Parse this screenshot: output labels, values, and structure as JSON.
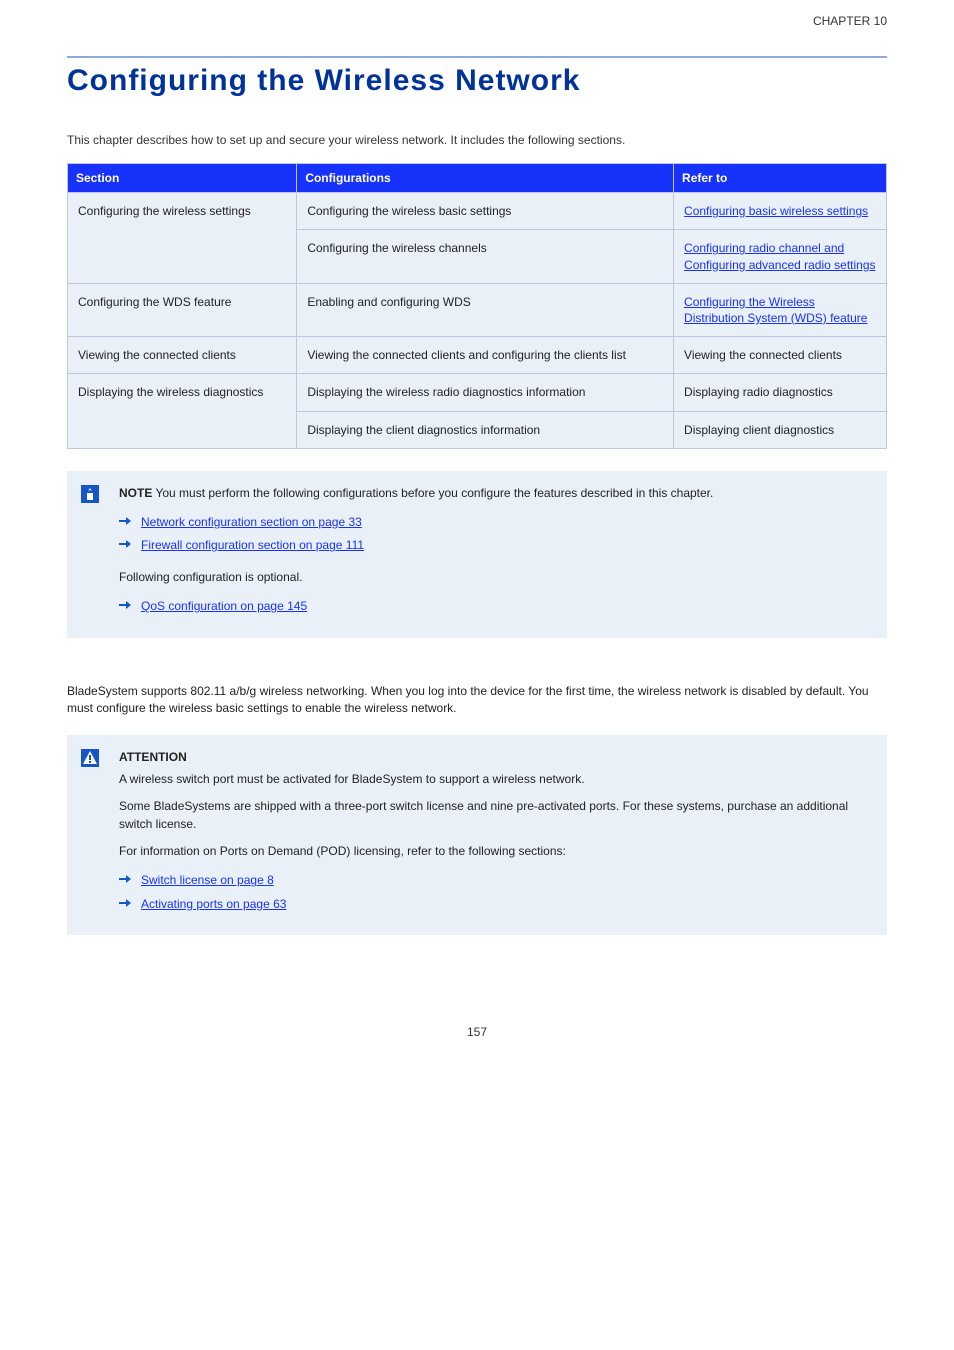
{
  "chapter": {
    "number_label": "CHAPTER 10",
    "title": "Configuring the Wireless Network",
    "intro": "This chapter describes how to set up and secure your wireless network. It includes the following sections.",
    "page_num": "157"
  },
  "table": {
    "headers": [
      "Section",
      "Configurations",
      "Refer to"
    ],
    "rows": [
      {
        "cells": [
          "Configuring the wireless settings",
          "Configuring the wireless basic settings",
          "Configuring basic wireless settings"
        ],
        "link": 2
      },
      {
        "cells": [
          "",
          "Configuring the wireless channels",
          "Configuring radio channel and Configuring advanced radio settings"
        ],
        "link": 2
      },
      {
        "cells": [
          "Configuring the WDS feature",
          "Enabling and configuring WDS",
          "Configuring the Wireless Distribution System (WDS) feature"
        ],
        "link": 2
      },
      {
        "cells": [
          "Viewing the connected clients",
          "Viewing the connected clients and configuring the clients list",
          "Viewing the connected clients"
        ],
        "link": 2
      },
      {
        "cells": [
          "Displaying the wireless diagnostics",
          "Displaying the wireless radio diagnostics information",
          "Displaying radio diagnostics"
        ],
        "link": 2
      },
      {
        "cells": [
          "",
          "Displaying the client diagnostics information",
          "Displaying client diagnostics"
        ],
        "link": 2
      }
    ]
  },
  "callout1": {
    "lead_strong": "NOTE",
    "lead_rest": " You must perform the following configurations before you configure the features described in this chapter.",
    "bullets": [
      {
        "link": "Network configuration section on page 33"
      },
      {
        "link": "Firewall configuration section on page 111"
      }
    ],
    "optional_lead": "Following configuration is optional.",
    "optional_bullet": {
      "link": "QoS configuration on page 145"
    }
  },
  "mid_para": "BladeSystem supports 802.11 a/b/g wireless networking. When you log into the device for the first time, the wireless network is disabled by default. You must configure the wireless basic settings to enable the wireless network.",
  "callout2": {
    "lead_strong": "ATTENTION",
    "lead_rest": "",
    "para1": "A wireless switch port must be activated for BladeSystem to support a wireless network.",
    "para2": "Some BladeSystems are shipped with a three-port switch license and nine pre-activated ports. For these systems, purchase an additional switch license.",
    "para3": "For information on Ports on Demand (POD) licensing, refer to the following sections:",
    "bullets": [
      {
        "link": "Switch license on page 8"
      },
      {
        "link": "Activating ports on page 63"
      }
    ]
  }
}
